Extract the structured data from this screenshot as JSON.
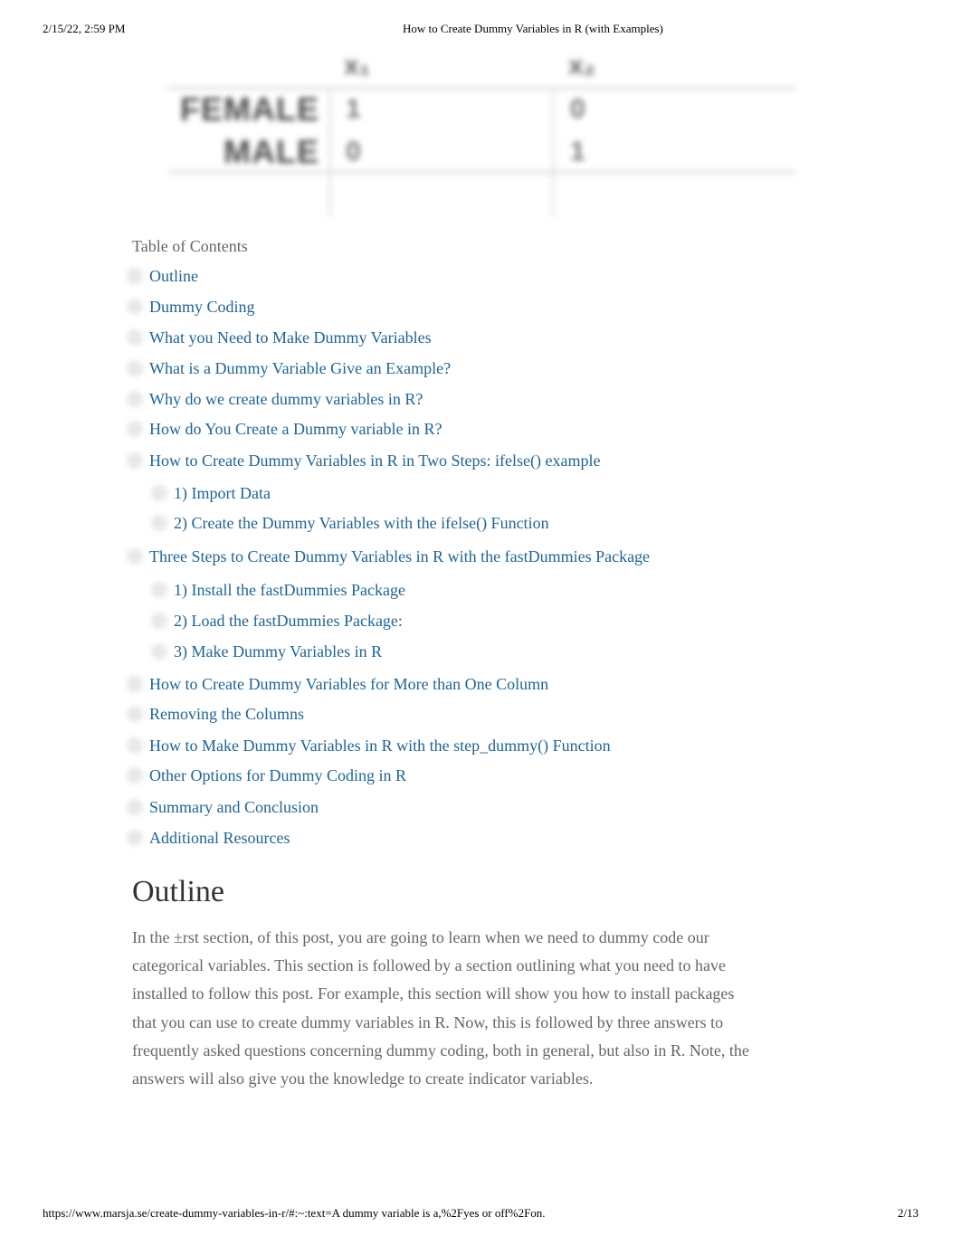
{
  "print_header": {
    "datetime": "2/15/22, 2:59 PM",
    "title": "How to Create Dummy Variables in R (with Examples)"
  },
  "dummy_table": {
    "columns": [
      "x₁",
      "x₂"
    ],
    "rows": [
      {
        "label": "FEMALE",
        "values": [
          "1",
          "0"
        ]
      },
      {
        "label": "MALE",
        "values": [
          "0",
          "1"
        ]
      }
    ]
  },
  "toc": {
    "title": "Table of Contents",
    "items": [
      {
        "label": "Outline",
        "level": 1
      },
      {
        "label": "Dummy Coding",
        "level": 1
      },
      {
        "label": "What you Need to Make Dummy Variables",
        "level": 1
      },
      {
        "label": "What is a Dummy Variable Give an Example?",
        "level": 1
      },
      {
        "label": "Why do we create dummy variables in R?",
        "level": 1
      },
      {
        "label": "How do You Create a Dummy variable in R?",
        "level": 1
      },
      {
        "label": "How to Create Dummy Variables in R in Two Steps: ifelse() example",
        "level": 1
      },
      {
        "label": "1) Import Data",
        "level": 2
      },
      {
        "label": "2) Create the Dummy Variables with the ifelse() Function",
        "level": 2
      },
      {
        "label": "Three Steps to Create Dummy Variables in R with the fastDummies Package",
        "level": 1
      },
      {
        "label": "1) Install the fastDummies Package",
        "level": 2
      },
      {
        "label": "2) Load the fastDummies Package:",
        "level": 2
      },
      {
        "label": "3) Make Dummy Variables in R",
        "level": 2
      },
      {
        "label": "How to Create Dummy Variables for More than One Column",
        "level": 1
      },
      {
        "label": "Removing the Columns",
        "level": 1
      },
      {
        "label": "How to Make Dummy Variables in R with the step_dummy() Function",
        "level": 1
      },
      {
        "label": "Other Options for Dummy Coding in R",
        "level": 1
      },
      {
        "label": "Summary and Conclusion",
        "level": 1
      },
      {
        "label": "Additional Resources",
        "level": 1
      }
    ]
  },
  "outline": {
    "heading": "Outline",
    "paragraph": "In the ±rst section, of this post, you are going to learn when we need to dummy code our categorical variables. This section is followed by a section outlining what you need to have installed to follow this post. For example, this section will show you how to install packages that you can use to create dummy variables in R. Now, this is followed by three answers to frequently asked questions concerning dummy coding, both in general, but also in R. Note, the answers will also give you the knowledge to create indicator variables."
  },
  "print_footer": {
    "url": "https://www.marsja.se/create-dummy-variables-in-r/#:~:text=A dummy variable is a,%2Fyes or off%2Fon.",
    "page": "2/13"
  },
  "colors": {
    "link": "#1f6496",
    "body_text": "#666666",
    "heading": "#333333"
  }
}
